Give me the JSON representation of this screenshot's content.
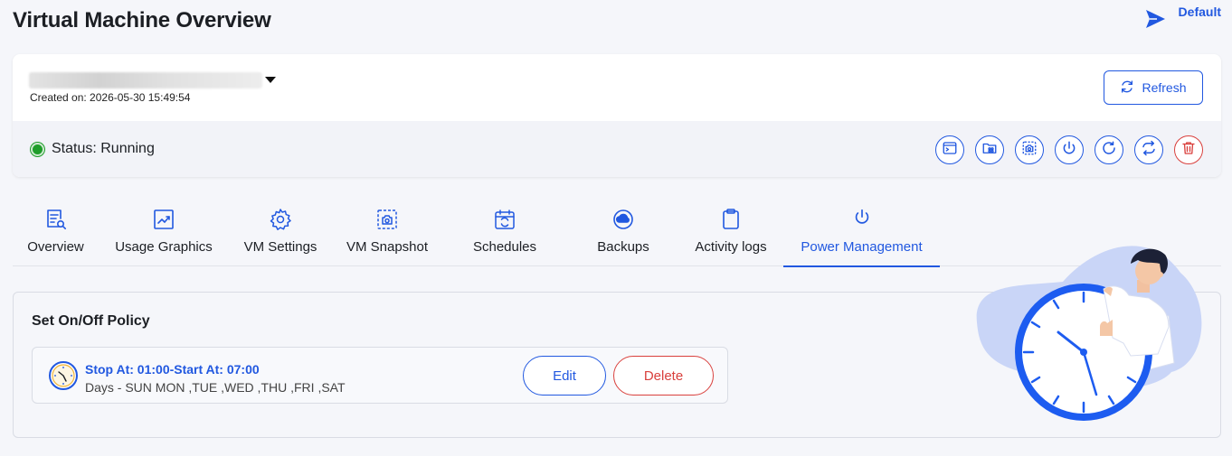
{
  "header": {
    "title": "Virtual Machine Overview",
    "default_link": "Default"
  },
  "vm": {
    "created_on": "Created on: 2026-05-30 15:49:54",
    "refresh_label": "Refresh",
    "status_label": "Status: Running",
    "status_color": "#1f9d2a"
  },
  "actions": [
    {
      "icon": "console-icon"
    },
    {
      "icon": "folder-apps-icon"
    },
    {
      "icon": "snapshot-icon"
    },
    {
      "icon": "power-icon"
    },
    {
      "icon": "restart-icon"
    },
    {
      "icon": "migrate-icon"
    },
    {
      "icon": "trash-icon"
    }
  ],
  "tabs": [
    {
      "label": "Overview",
      "icon": "document-search-icon"
    },
    {
      "label": "Usage Graphics",
      "icon": "chart-icon"
    },
    {
      "label": "VM Settings",
      "icon": "gear-icon"
    },
    {
      "label": "VM Snapshot",
      "icon": "camera-frame-icon"
    },
    {
      "label": "Schedules",
      "icon": "calendar-refresh-icon"
    },
    {
      "label": "Backups",
      "icon": "cloud-backup-icon"
    },
    {
      "label": "Activity logs",
      "icon": "clipboard-icon"
    },
    {
      "label": "Power Management",
      "icon": "power-icon",
      "active": true
    }
  ],
  "policy": {
    "title": "Set On/Off Policy",
    "time": "Stop At: 01:00-Start At: 07:00",
    "days": "Days - SUN MON ,TUE ,WED ,THU ,FRI ,SAT",
    "edit_label": "Edit",
    "delete_label": "Delete"
  },
  "colors": {
    "accent": "#2158e0",
    "danger": "#d9403d"
  }
}
